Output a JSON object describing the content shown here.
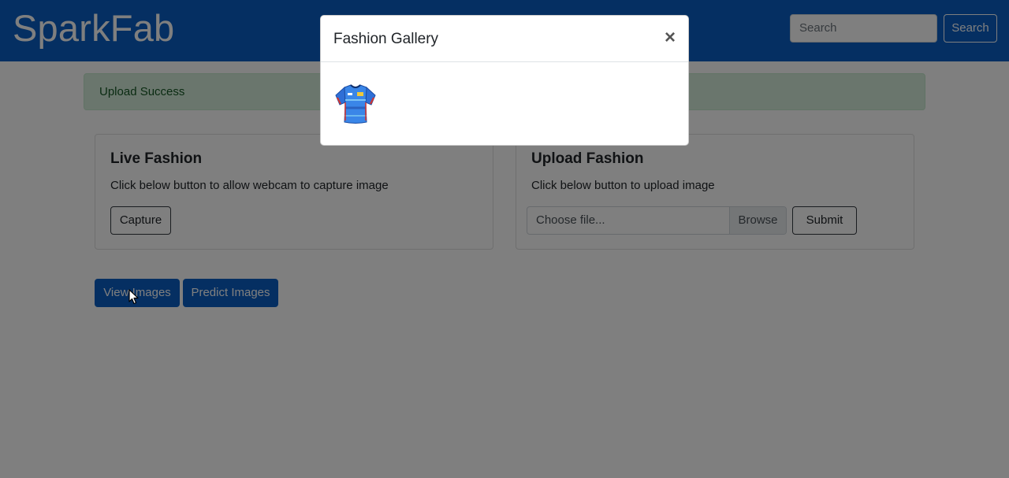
{
  "navbar": {
    "brand": "SparkFab",
    "search_placeholder": "Search",
    "search_button": "Search"
  },
  "alert": {
    "text": "Upload Success"
  },
  "live_card": {
    "title": "Live Fashion",
    "text": "Click below button to allow webcam to capture image",
    "capture_button": "Capture"
  },
  "upload_card": {
    "title": "Upload Fashion",
    "text": "Click below button to upload image",
    "file_placeholder": "Choose file...",
    "browse_label": "Browse",
    "submit_button": "Submit"
  },
  "actions": {
    "view_button": "View Images",
    "predict_button": "Predict Images"
  },
  "modal": {
    "title": "Fashion Gallery",
    "close": "×",
    "images": [
      {
        "icon": "jersey-icon"
      }
    ]
  },
  "colors": {
    "primary": "#0a5fc4",
    "alert_bg": "#d4edda",
    "alert_text": "#155724"
  }
}
